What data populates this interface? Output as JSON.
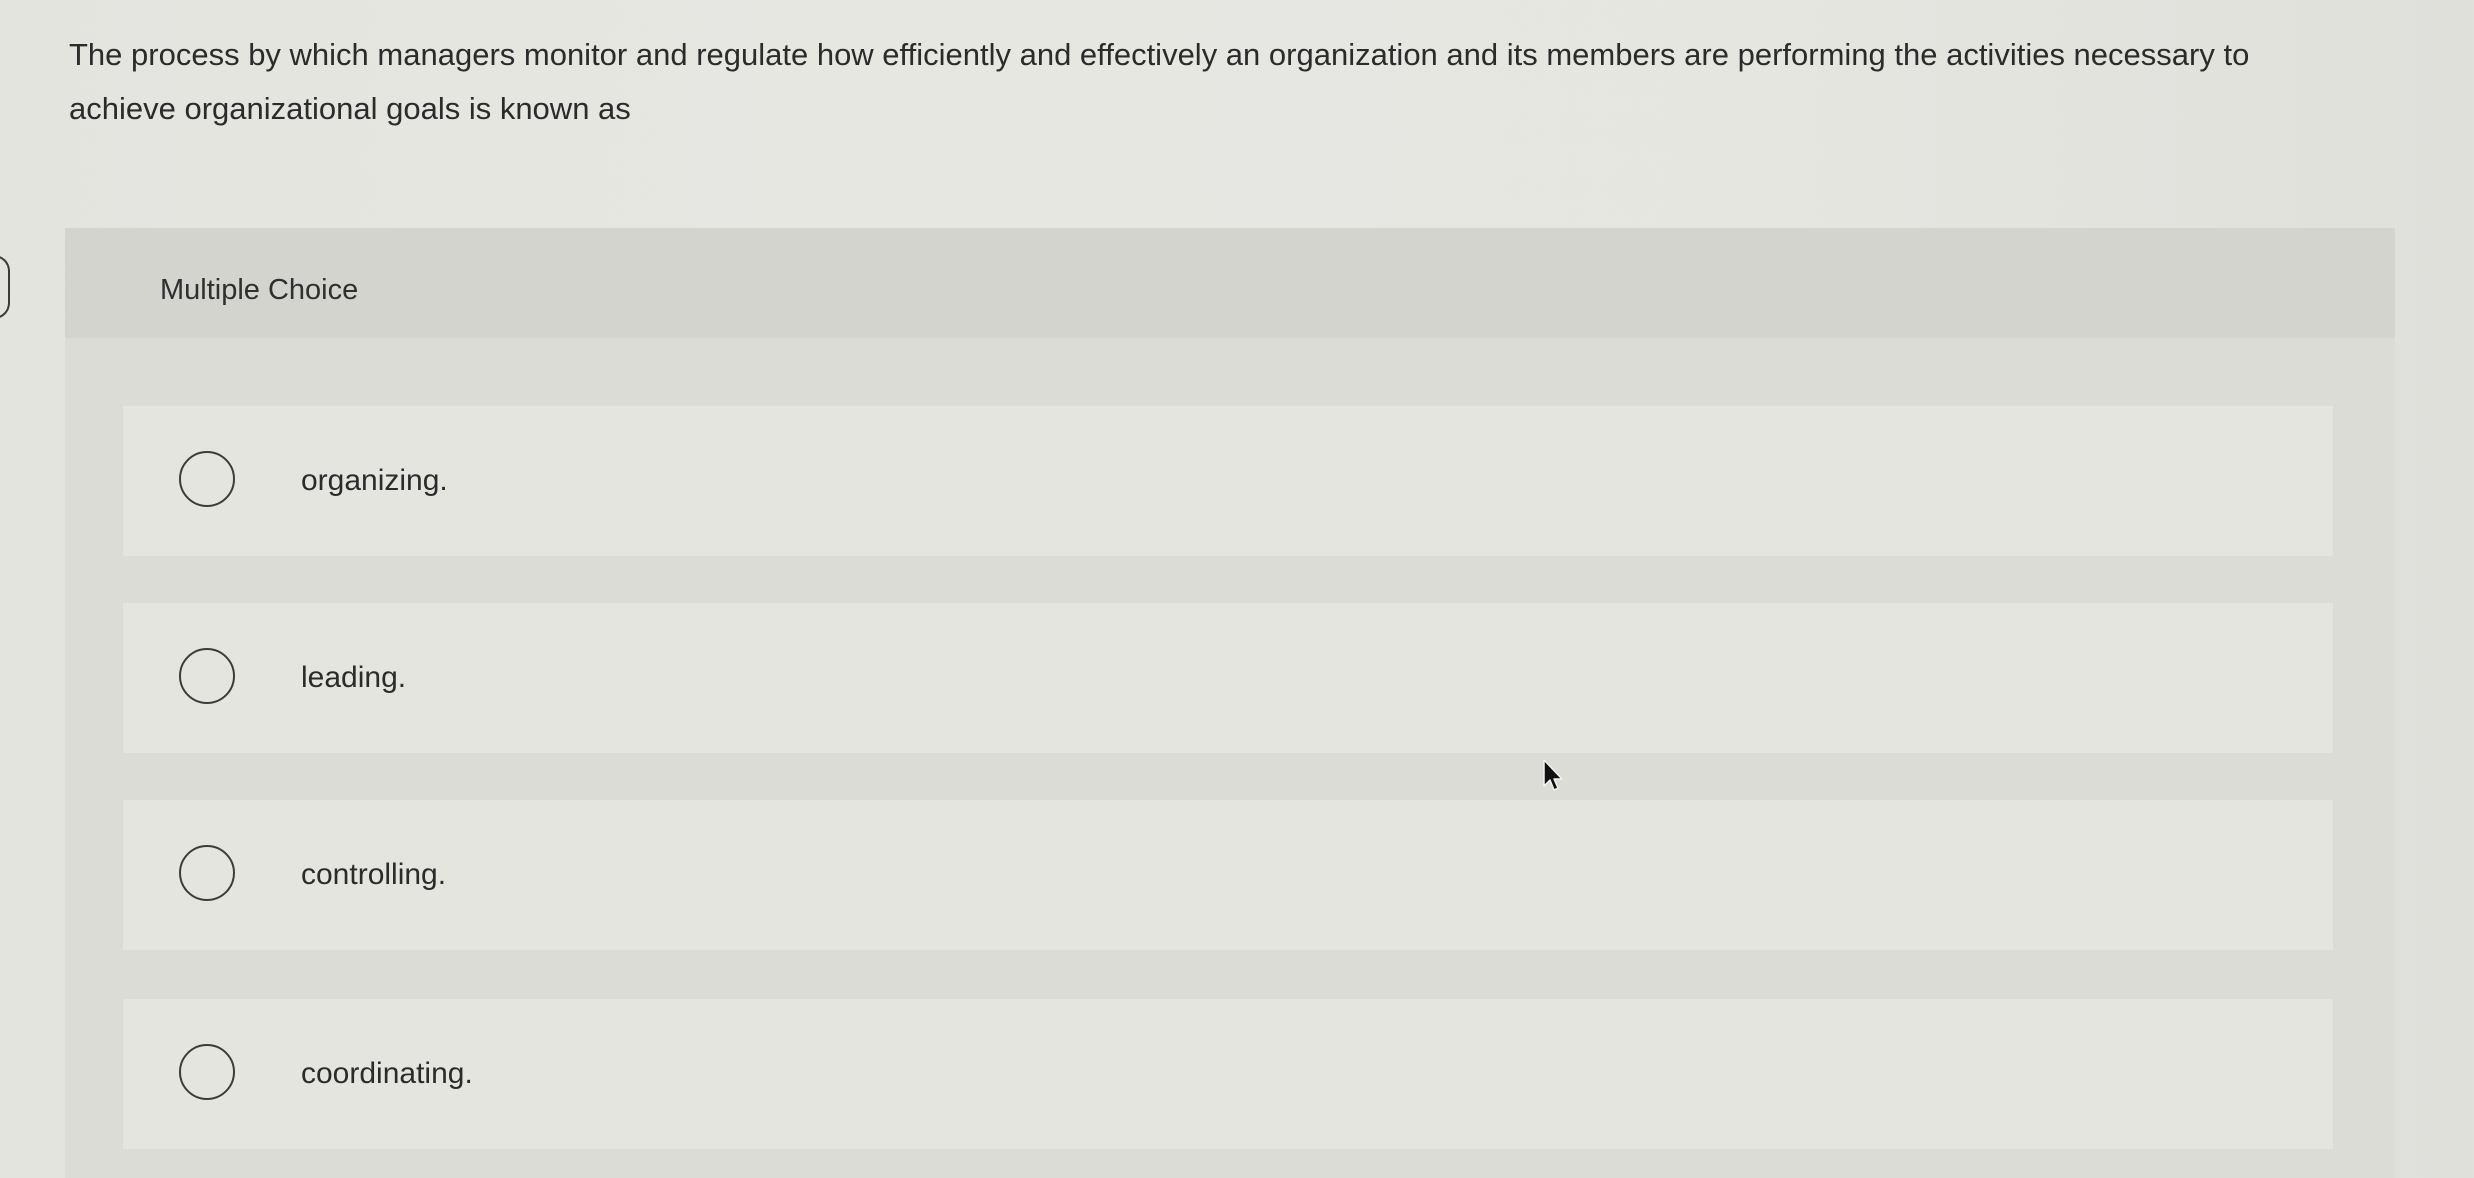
{
  "question": {
    "text": "The process by which managers monitor and regulate how efficiently and effectively an organization and its members are performing the activities necessary to achieve organizational goals is known as"
  },
  "panel": {
    "header_label": "Multiple Choice"
  },
  "options": [
    {
      "label": "organizing.",
      "selected": false
    },
    {
      "label": "leading.",
      "selected": false
    },
    {
      "label": "controlling.",
      "selected": false
    },
    {
      "label": "coordinating.",
      "selected": false
    }
  ],
  "icons": {
    "radio": "radio-unselected-icon",
    "cursor": "mouse-pointer-icon"
  },
  "colors": {
    "background": "#e6e6e1",
    "panel": "#dcdcd7",
    "panel_header": "#d4d4cf",
    "option_row": "#e5e5e0",
    "text": "#2b2b2b"
  }
}
